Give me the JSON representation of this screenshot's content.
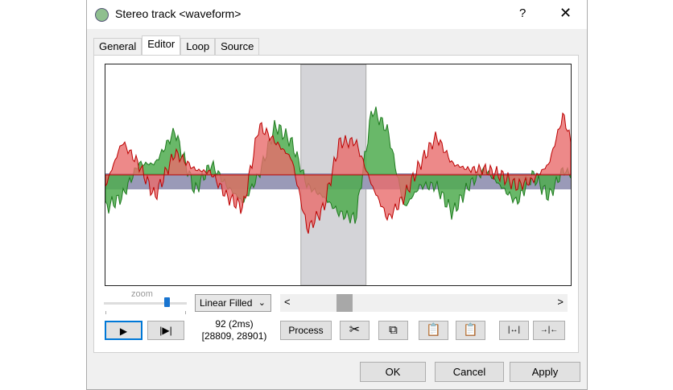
{
  "window": {
    "title": "Stereo track <waveform>",
    "help": "?",
    "close": "✕"
  },
  "tabs": [
    {
      "label": "General"
    },
    {
      "label": "Editor"
    },
    {
      "label": "Loop"
    },
    {
      "label": "Source"
    }
  ],
  "editor": {
    "zoom_label": "zoom",
    "zoom_level": 0.78,
    "display_mode": "Linear Filled",
    "scroll_left": "<",
    "scroll_right": ">",
    "sample_count": "92 (2ms)",
    "sample_range": "[28809, 28901)",
    "process_label": "Process",
    "selection": [
      0.42,
      0.56
    ],
    "colors": {
      "left": "#4fac4f",
      "right": "#e86b6b",
      "overlap": "#9a9ab8",
      "selection": "#d4d4d8"
    },
    "waveform": {
      "x": [
        0,
        0.036,
        0.071,
        0.106,
        0.149,
        0.192,
        0.227,
        0.261,
        0.296,
        0.33,
        0.365,
        0.4,
        0.434,
        0.469,
        0.503,
        0.538,
        0.573,
        0.607,
        0.642,
        0.676,
        0.711,
        0.746,
        0.78,
        0.815,
        0.849,
        0.884,
        0.918,
        0.953,
        0.984,
        1
      ],
      "left": [
        -0.3,
        -0.2,
        0.1,
        0.1,
        0.4,
        -0.15,
        0.1,
        -0.1,
        -0.25,
        0.0,
        0.45,
        0.3,
        -0.1,
        -0.2,
        -0.35,
        -0.4,
        0.6,
        0.4,
        -0.3,
        -0.1,
        -0.1,
        -0.35,
        -0.1,
        0.05,
        -0.1,
        -0.25,
        0.0,
        -0.2,
        0.05,
        0.0
      ],
      "right": [
        -0.1,
        0.3,
        0.1,
        -0.2,
        0.2,
        0.05,
        0.02,
        -0.2,
        -0.3,
        0.45,
        0.3,
        0.15,
        -0.5,
        -0.3,
        0.3,
        0.3,
        -0.1,
        -0.4,
        -0.2,
        0.1,
        0.35,
        0.1,
        0.05,
        0.05,
        0.0,
        -0.1,
        -0.05,
        0.1,
        0.55,
        0.3
      ]
    }
  },
  "dialog_buttons": {
    "ok": "OK",
    "cancel": "Cancel",
    "apply": "Apply"
  }
}
